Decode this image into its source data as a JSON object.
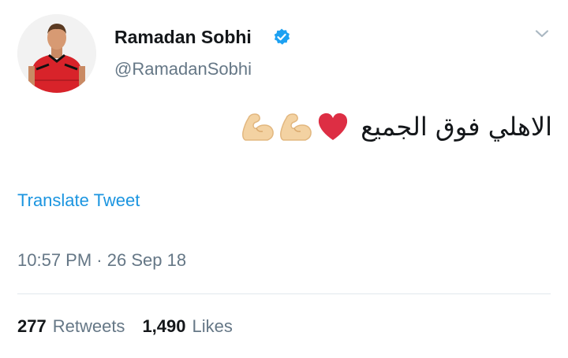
{
  "user": {
    "display_name": "Ramadan Sobhi",
    "handle": "@RamadanSobhi",
    "verified": true
  },
  "tweet": {
    "text": "الاهلي فوق الجميع",
    "emojis": [
      "heart-icon",
      "flexed-biceps-icon",
      "flexed-biceps-icon"
    ],
    "translate_label": "Translate Tweet",
    "time": "10:57 PM",
    "separator": "·",
    "date": "26 Sep 18"
  },
  "stats": {
    "retweets_count": "277",
    "retweets_label": "Retweets",
    "likes_count": "1,490",
    "likes_label": "Likes"
  },
  "colors": {
    "text": "#14171a",
    "secondary": "#657786",
    "link": "#1b95e0",
    "verified": "#1da1f2",
    "heart": "#dd2e44",
    "biceps": "#f3d2a2",
    "divider": "#e1e8ed"
  }
}
